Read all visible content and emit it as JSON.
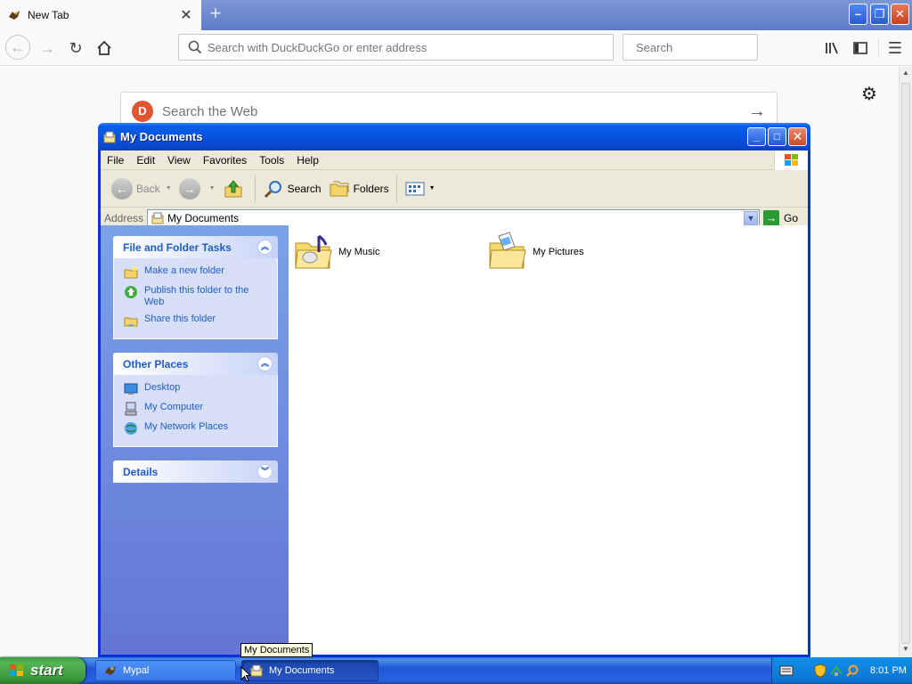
{
  "browser": {
    "tab_title": "New Tab",
    "tab_close": "✕",
    "new_tab": "+",
    "url_placeholder": "Search with DuckDuckGo or enter address",
    "search_placeholder": "Search",
    "ddg_placeholder": "Search the Web",
    "ddg_go": "→",
    "window_min": "–",
    "window_max": "❐",
    "window_close": "✕"
  },
  "explorer": {
    "title": "My Documents",
    "menu": [
      "File",
      "Edit",
      "View",
      "Favorites",
      "Tools",
      "Help"
    ],
    "toolbar": {
      "back": "Back",
      "search": "Search",
      "folders": "Folders"
    },
    "address": {
      "label": "Address",
      "value": "My Documents",
      "go": "Go"
    },
    "task_pane": {
      "file_tasks": {
        "title": "File and Folder Tasks",
        "items": [
          "Make a new folder",
          "Publish this folder to the Web",
          "Share this folder"
        ]
      },
      "other_places": {
        "title": "Other Places",
        "items": [
          "Desktop",
          "My Computer",
          "My Network Places"
        ]
      },
      "details": {
        "title": "Details"
      }
    },
    "files": [
      "My Music",
      "My Pictures"
    ]
  },
  "tooltip": "My Documents",
  "taskbar": {
    "start": "start",
    "tasks": [
      "Mypal",
      "My Documents"
    ],
    "clock": "8:01 PM"
  },
  "colors": {
    "xp_title_blue": "#0553e0",
    "task_link_blue": "#215dc6",
    "start_green": "#3d983d"
  }
}
